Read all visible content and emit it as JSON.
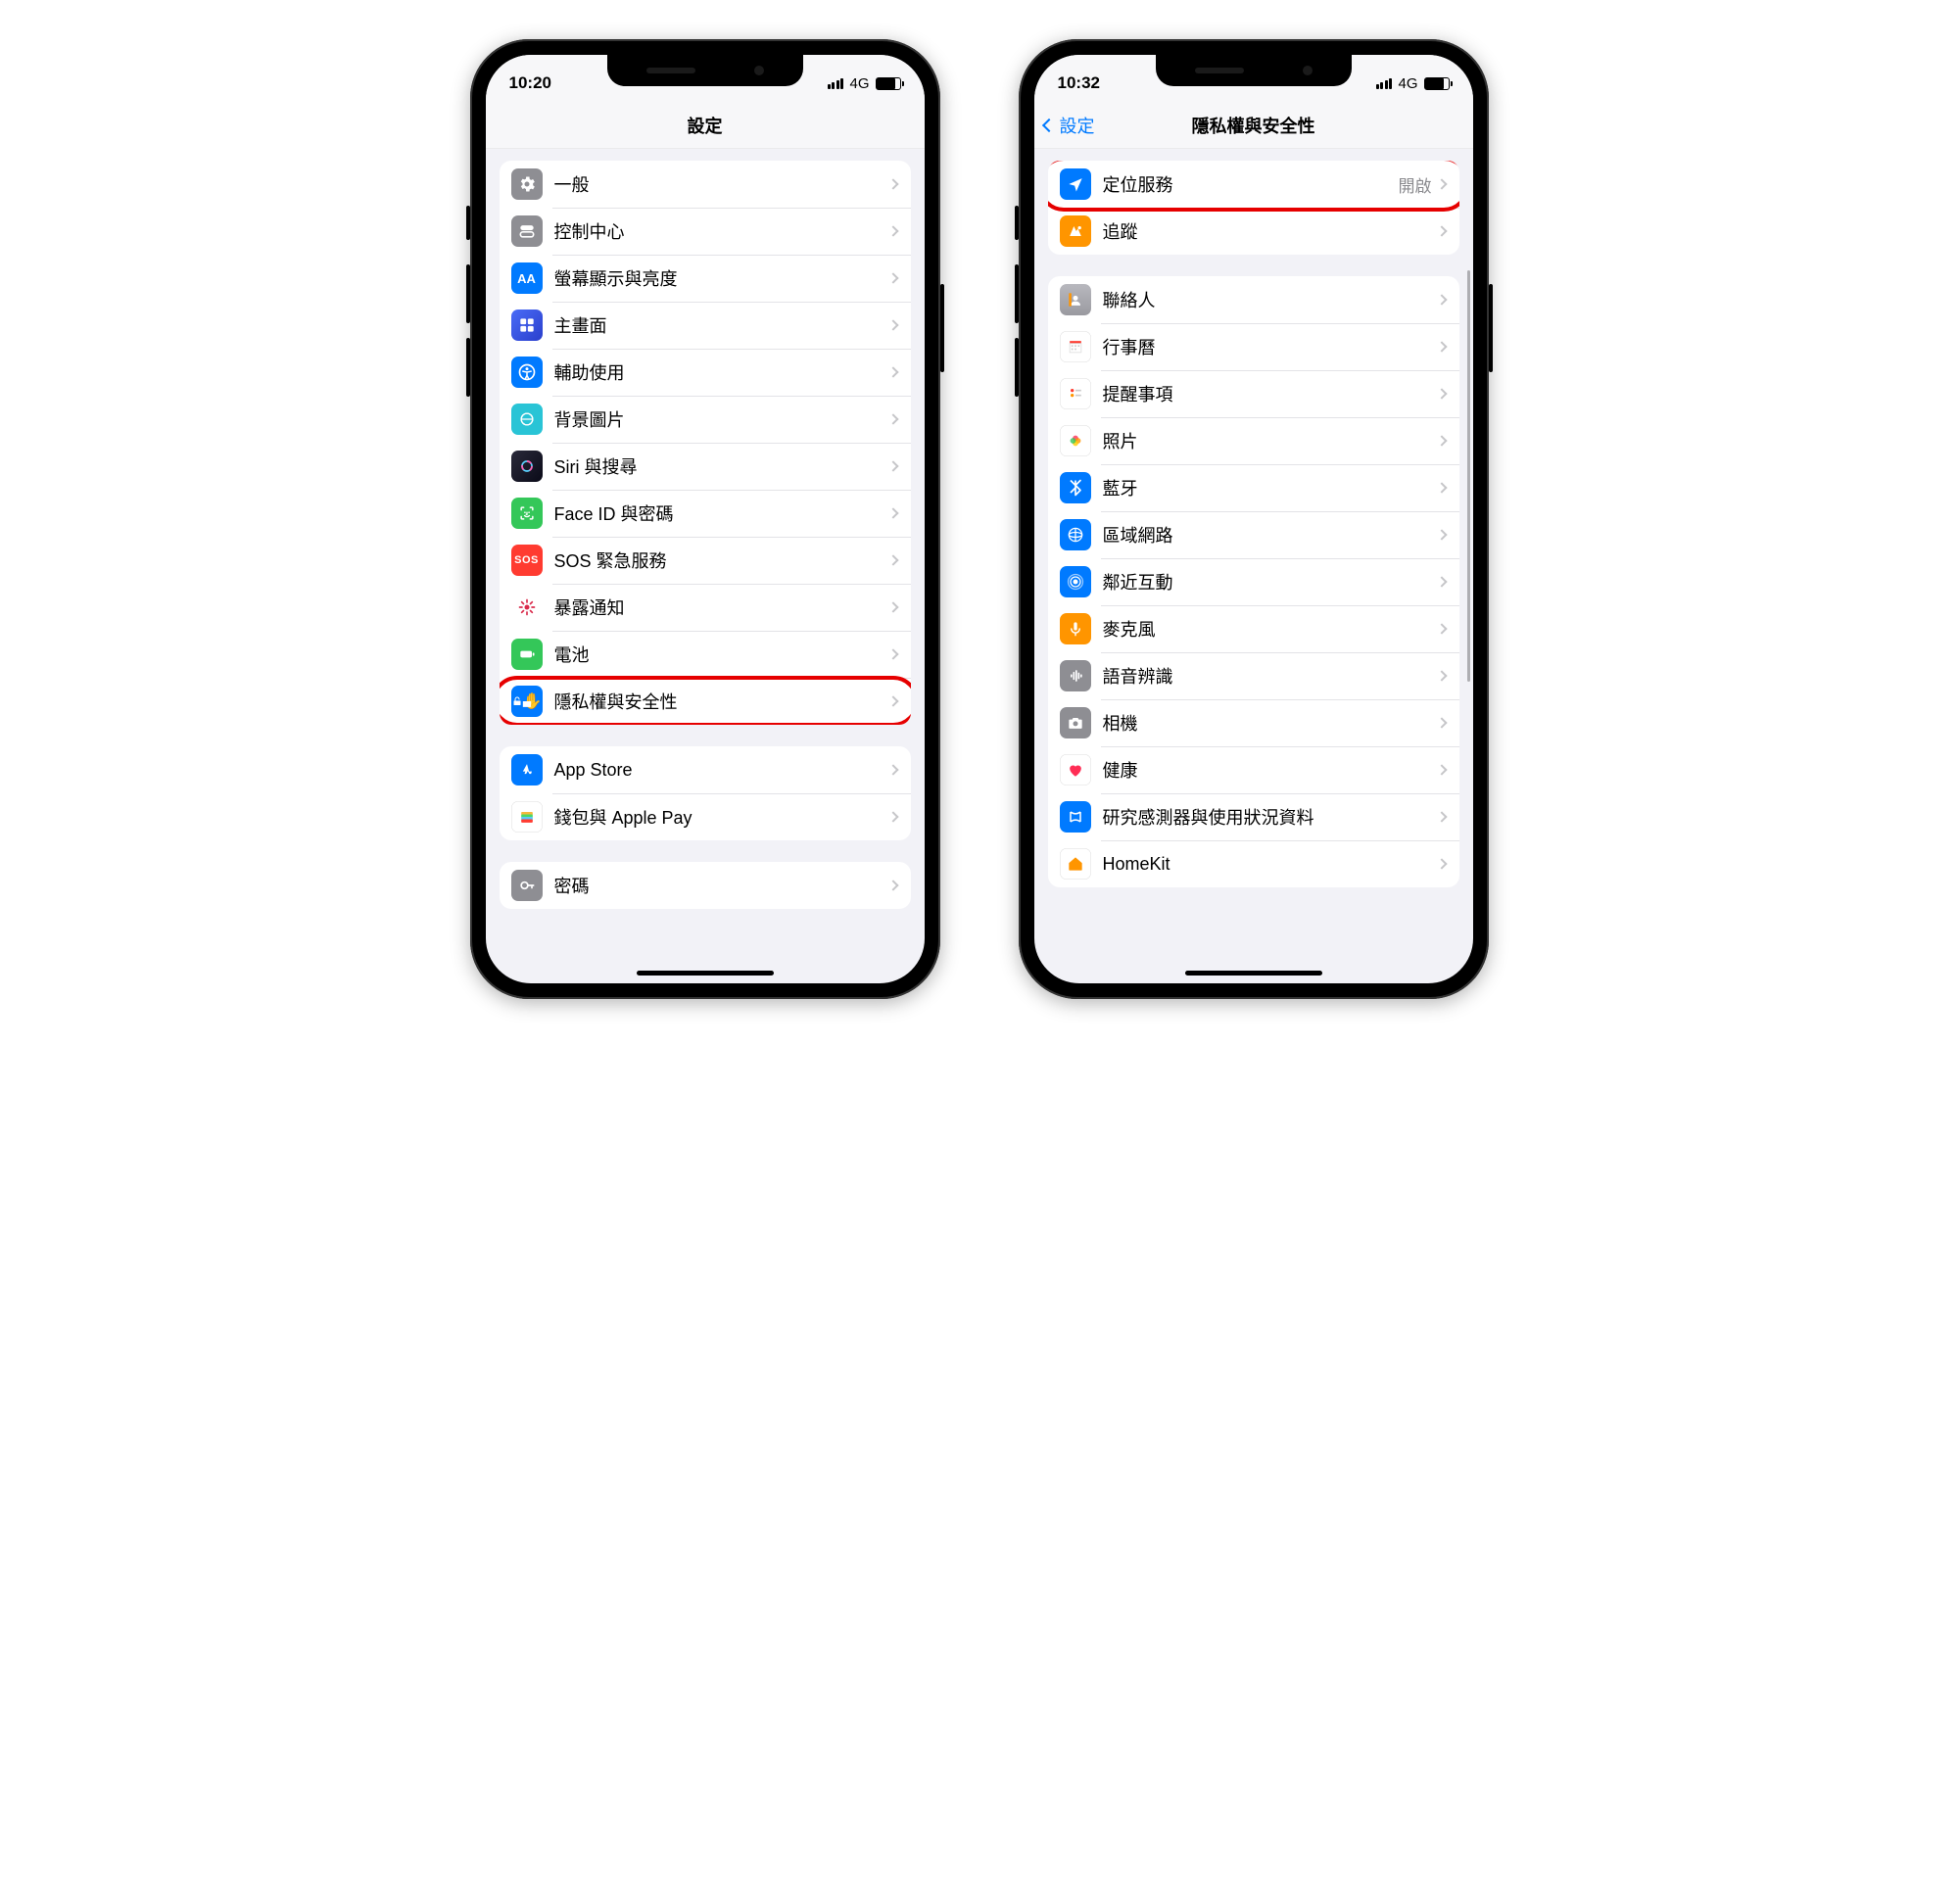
{
  "left": {
    "status": {
      "time": "10:20",
      "net": "4G"
    },
    "nav": {
      "title": "設定"
    },
    "group1": [
      {
        "icon": "gear-icon",
        "label": "一般"
      },
      {
        "icon": "control-icon",
        "label": "控制中心"
      },
      {
        "icon": "display-icon",
        "label": "螢幕顯示與亮度"
      },
      {
        "icon": "home-icon",
        "label": "主畫面"
      },
      {
        "icon": "accessibility-icon",
        "label": "輔助使用"
      },
      {
        "icon": "wallpaper-icon",
        "label": "背景圖片"
      },
      {
        "icon": "siri-icon",
        "label": "Siri 與搜尋"
      },
      {
        "icon": "faceid-icon",
        "label": "Face ID 與密碼"
      },
      {
        "icon": "sos-icon",
        "label": "SOS 緊急服務"
      },
      {
        "icon": "exposure-icon",
        "label": "暴露通知"
      },
      {
        "icon": "battery-icon",
        "label": "電池"
      },
      {
        "icon": "privacy-icon",
        "label": "隱私權與安全性",
        "highlight": true
      }
    ],
    "group2": [
      {
        "icon": "appstore-icon",
        "label": "App Store"
      },
      {
        "icon": "wallet-icon",
        "label": "錢包與 Apple Pay"
      }
    ],
    "group3": [
      {
        "icon": "password-icon",
        "label": "密碼"
      }
    ]
  },
  "right": {
    "status": {
      "time": "10:32",
      "net": "4G"
    },
    "nav": {
      "back": "設定",
      "title": "隱私權與安全性"
    },
    "group1": [
      {
        "icon": "location-icon",
        "label": "定位服務",
        "value": "開啟",
        "highlight": true
      },
      {
        "icon": "tracking-icon",
        "label": "追蹤"
      }
    ],
    "group2": [
      {
        "icon": "contacts-icon",
        "label": "聯絡人"
      },
      {
        "icon": "calendar-icon",
        "label": "行事曆"
      },
      {
        "icon": "reminders-icon",
        "label": "提醒事項"
      },
      {
        "icon": "photos-icon",
        "label": "照片"
      },
      {
        "icon": "bluetooth-icon",
        "label": "藍牙"
      },
      {
        "icon": "localnet-icon",
        "label": "區域網路"
      },
      {
        "icon": "nearby-icon",
        "label": "鄰近互動"
      },
      {
        "icon": "mic-icon",
        "label": "麥克風"
      },
      {
        "icon": "speech-icon",
        "label": "語音辨識"
      },
      {
        "icon": "camera-icon",
        "label": "相機"
      },
      {
        "icon": "health-icon",
        "label": "健康"
      },
      {
        "icon": "research-icon",
        "label": "研究感測器與使用狀況資料"
      },
      {
        "icon": "homekit-icon",
        "label": "HomeKit"
      }
    ]
  }
}
